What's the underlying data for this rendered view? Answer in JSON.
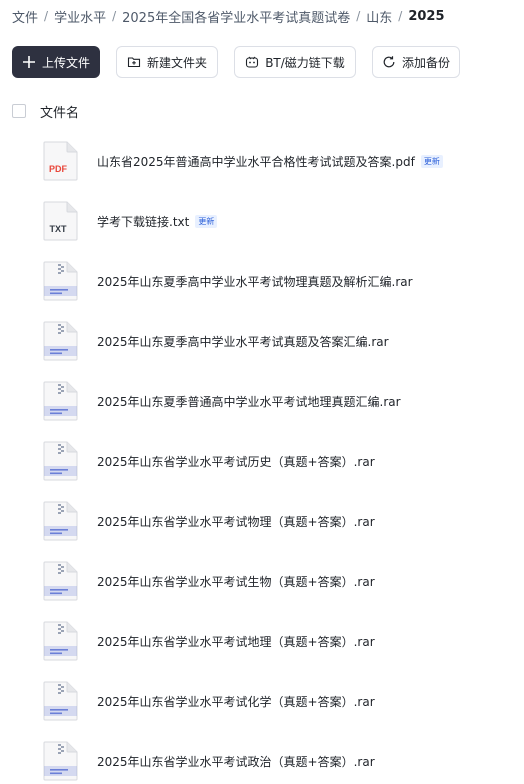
{
  "breadcrumb": {
    "items": [
      "文件",
      "学业水平",
      "2025年全国各省学业水平考试真题试卷",
      "山东"
    ],
    "separator": "/",
    "current": "2025"
  },
  "toolbar": {
    "upload_label": "上传文件",
    "new_folder_label": "新建文件夹",
    "bt_label": "BT/磁力链下载",
    "backup_label": "添加备份"
  },
  "list": {
    "header_label": "文件名",
    "badge_label": "更新",
    "icon_labels": {
      "pdf": "PDF",
      "txt": "TXT"
    },
    "files": [
      {
        "name": "山东省2025年普通高中学业水平合格性考试试题及答案.pdf",
        "type": "pdf",
        "updated": true
      },
      {
        "name": "学考下载链接.txt",
        "type": "txt",
        "updated": true
      },
      {
        "name": "2025年山东夏季高中学业水平考试物理真题及解析汇编.rar",
        "type": "rar",
        "updated": false
      },
      {
        "name": "2025年山东夏季高中学业水平考试真题及答案汇编.rar",
        "type": "rar",
        "updated": false
      },
      {
        "name": "2025年山东夏季普通高中学业水平考试地理真题汇编.rar",
        "type": "rar",
        "updated": false
      },
      {
        "name": "2025年山东省学业水平考试历史（真题+答案）.rar",
        "type": "rar",
        "updated": false
      },
      {
        "name": "2025年山东省学业水平考试物理（真题+答案）.rar",
        "type": "rar",
        "updated": false
      },
      {
        "name": "2025年山东省学业水平考试生物（真题+答案）.rar",
        "type": "rar",
        "updated": false
      },
      {
        "name": "2025年山东省学业水平考试地理（真题+答案）.rar",
        "type": "rar",
        "updated": false
      },
      {
        "name": "2025年山东省学业水平考试化学（真题+答案）.rar",
        "type": "rar",
        "updated": false
      },
      {
        "name": "2025年山东省学业水平考试政治（真题+答案）.rar",
        "type": "rar",
        "updated": false
      }
    ]
  },
  "colors": {
    "primary_button": "#2e3140",
    "pdf_red": "#e8463a",
    "badge_blue": "#2b5fd9",
    "archive_blue": "#6b7fd7"
  }
}
